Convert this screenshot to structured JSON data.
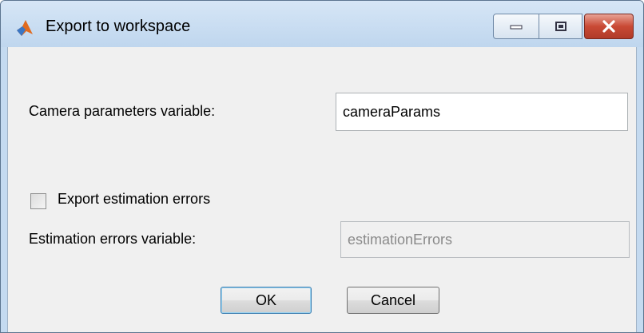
{
  "window": {
    "title": "Export to workspace",
    "controls": {
      "minimize": "minimize-icon",
      "maximize": "maximize-icon",
      "close": "close-icon"
    },
    "app_icon": "matlab-icon"
  },
  "form": {
    "camera_label": "Camera parameters variable:",
    "camera_value": "cameraParams",
    "export_errors_label": "Export estimation errors",
    "export_errors_checked": false,
    "errors_var_label": "Estimation errors variable:",
    "errors_var_value": "estimationErrors",
    "errors_var_disabled": true
  },
  "buttons": {
    "ok": "OK",
    "cancel": "Cancel"
  },
  "colors": {
    "titlebar": "#c4daf0",
    "client": "#f0f0f0",
    "close": "#c94a35"
  }
}
